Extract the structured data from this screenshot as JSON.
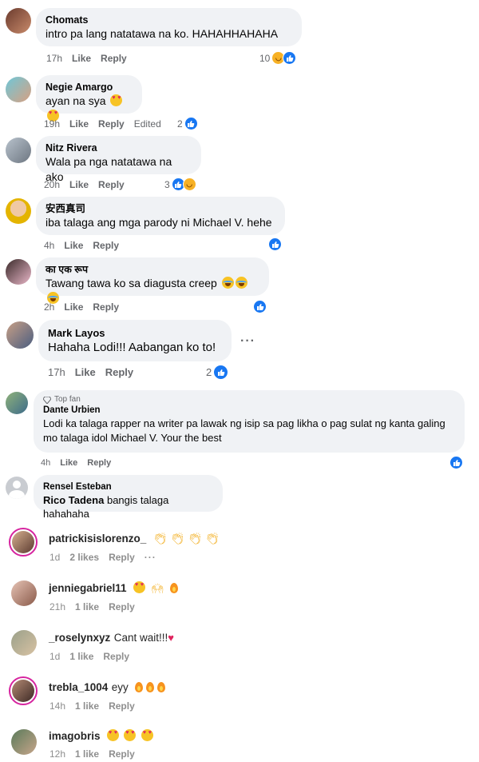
{
  "fb_comments": [
    {
      "name": "Chomats",
      "text": "intro pa lang natatawa na ko. HAHAHHAHAHA",
      "time": "17h",
      "like": "Like",
      "reply": "Reply",
      "edited": "",
      "reaction_count": "10"
    },
    {
      "name": "Negie Amargo",
      "text": "ayan na sya",
      "time": "19h",
      "like": "Like",
      "reply": "Reply",
      "edited": "Edited",
      "reaction_count": "2"
    },
    {
      "name": "Nitz Rivera",
      "text": "Wala pa nga natatawa na ako",
      "time": "20h",
      "like": "Like",
      "reply": "Reply",
      "edited": "",
      "reaction_count": "3"
    },
    {
      "name": "安西真司",
      "text": "iba talaga ang mga parody ni Michael V. hehe",
      "time": "4h",
      "like": "Like",
      "reply": "Reply",
      "edited": "",
      "reaction_count": ""
    },
    {
      "name": "का एक रूप",
      "text": "Tawang tawa ko sa diagusta creep",
      "time": "2h",
      "like": "Like",
      "reply": "Reply",
      "edited": "",
      "reaction_count": ""
    },
    {
      "name": "Mark Layos",
      "text": "Hahaha Lodi!!! Aabangan ko to!",
      "time": "17h",
      "like": "Like",
      "reply": "Reply",
      "edited": "",
      "reaction_count": "2"
    },
    {
      "name": "Dante Urbien",
      "badge": "Top fan",
      "text": "Lodi ka talaga rapper na writer pa lawak ng isip sa pag likha o pag sulat ng kanta galing mo talaga idol Michael V. Your the best",
      "time": "4h",
      "like": "Like",
      "reply": "Reply",
      "edited": "",
      "reaction_count": ""
    },
    {
      "name": "Rensel Esteban",
      "mention": "Rico Tadena",
      "text": "bangis talaga hahahaha"
    }
  ],
  "ig_comments": [
    {
      "user": "patrickisislorenzo_",
      "text": "",
      "time": "1d",
      "likes": "2 likes",
      "reply": "Reply"
    },
    {
      "user": "jenniegabriel11",
      "text": "",
      "time": "21h",
      "likes": "1 like",
      "reply": "Reply"
    },
    {
      "user": "_roselynxyz",
      "text": "Cant wait!!!",
      "time": "1d",
      "likes": "1 like",
      "reply": "Reply"
    },
    {
      "user": "trebla_1004",
      "text": "eyy",
      "time": "14h",
      "likes": "1 like",
      "reply": "Reply"
    },
    {
      "user": "imagobris",
      "text": "",
      "time": "12h",
      "likes": "1 like",
      "reply": "Reply"
    }
  ],
  "icons": {
    "like": "thumbs-up-icon",
    "haha": "haha-icon",
    "more": "more-options-icon",
    "top_fan": "diamond-icon"
  },
  "colors": {
    "fb_blue": "#1877f2",
    "bubble": "#f0f2f5",
    "meta": "#65676b"
  }
}
